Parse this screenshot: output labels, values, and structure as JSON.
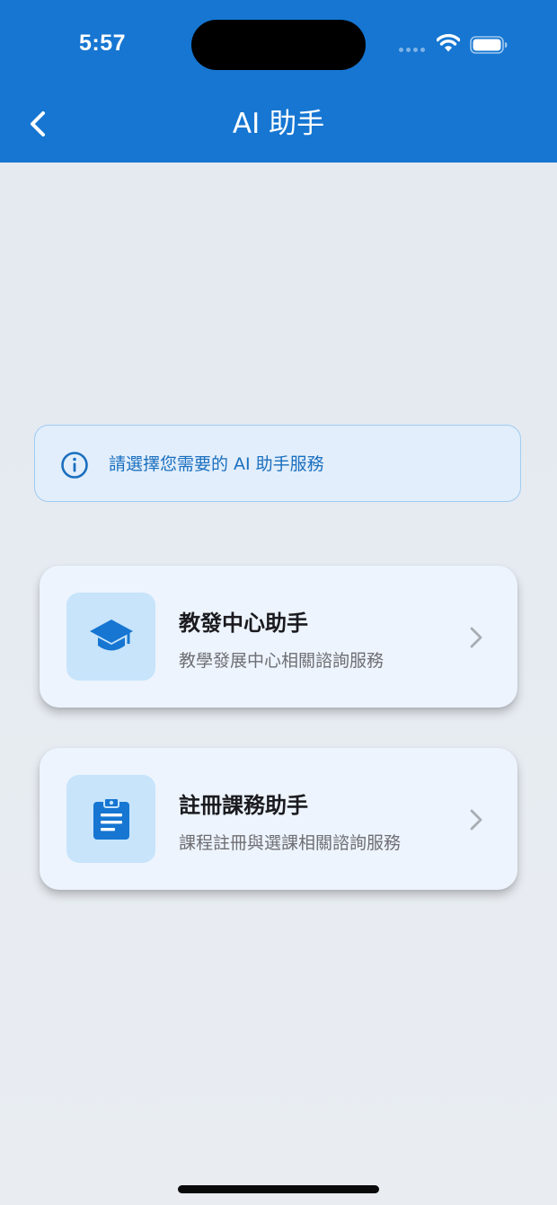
{
  "status_bar": {
    "time": "5:57"
  },
  "nav": {
    "title": "AI 助手",
    "back_icon": "chevron-left-icon"
  },
  "banner": {
    "icon": "info-icon",
    "text": "請選擇您需要的 AI 助手服務"
  },
  "services": [
    {
      "icon": "graduation-cap-icon",
      "title": "教發中心助手",
      "description": "教學發展中心相關諮詢服務"
    },
    {
      "icon": "clipboard-icon",
      "title": "註冊課務助手",
      "description": "課程註冊與選課相關諮詢服務"
    }
  ],
  "colors": {
    "header": "#1676d2",
    "accent": "#1a6fbf",
    "icon_box": "#c7e4fb",
    "card": "#edf4fd"
  }
}
